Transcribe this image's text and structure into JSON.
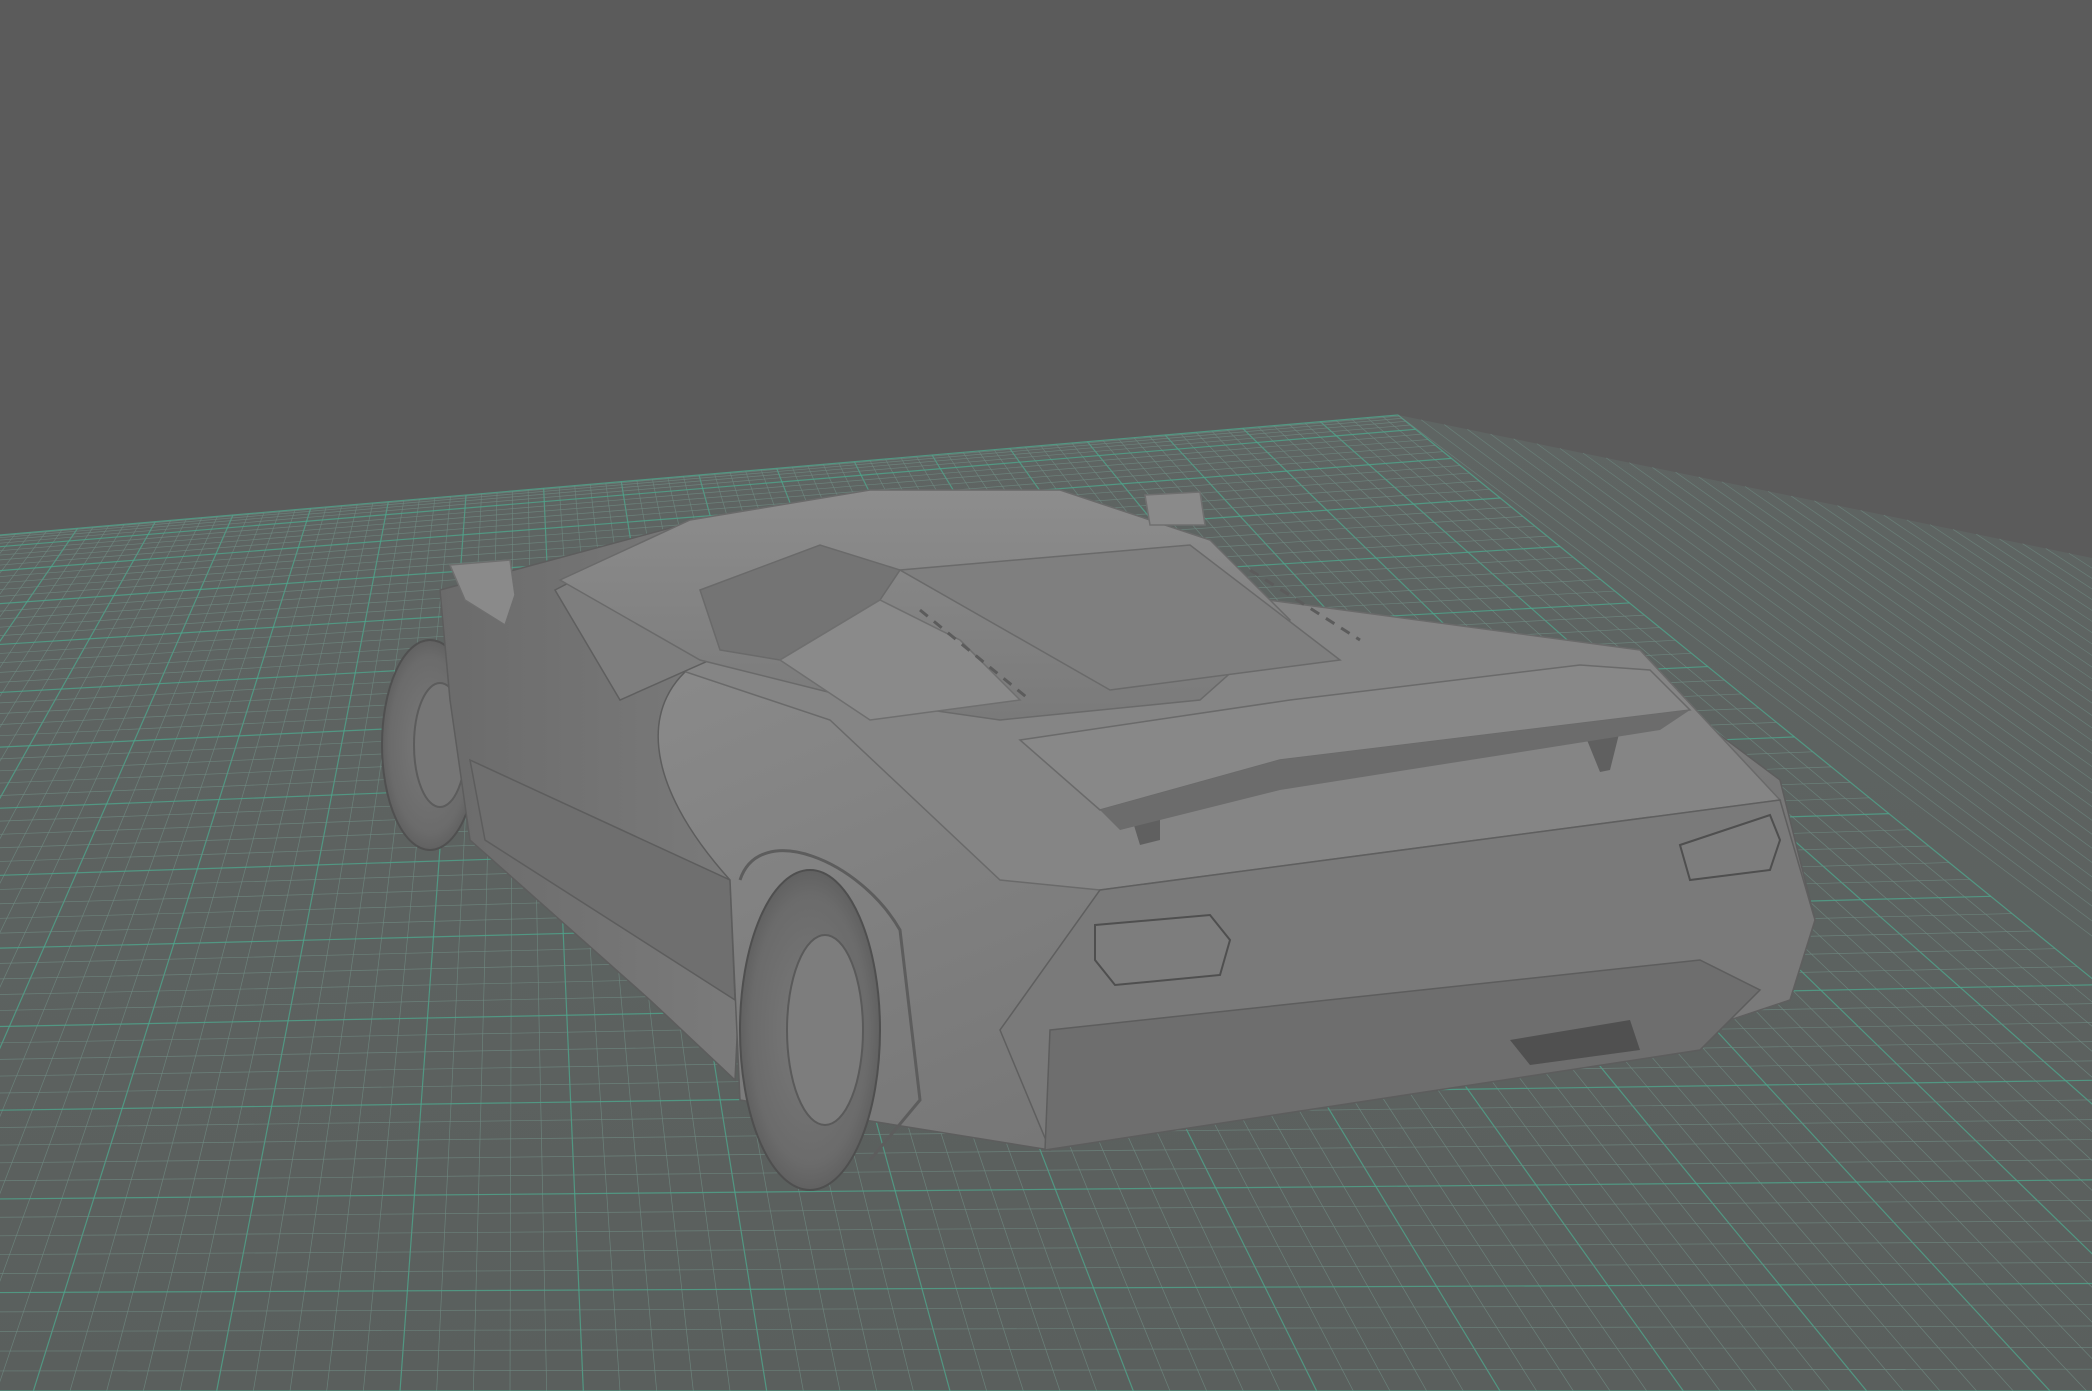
{
  "viewport": {
    "background_color": "#5b5b5b",
    "grid_color": "#4fa58c",
    "grid_minor_color": "#6f8a82",
    "grid_visible": true,
    "view": "perspective",
    "shading": "smooth-shaded"
  },
  "scene": {
    "model": "car-body-mesh",
    "model_color": "#7a7a7a",
    "objects": [
      "ground-grid",
      "car-body",
      "rear-wing",
      "left-mirror",
      "right-mirror",
      "front-left-wheel",
      "rear-left-wheel",
      "exhaust"
    ]
  }
}
